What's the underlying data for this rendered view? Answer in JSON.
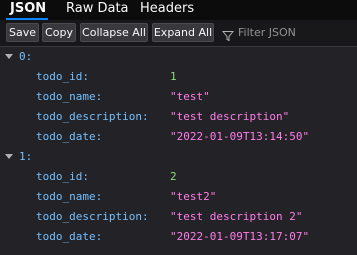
{
  "tabs": [
    {
      "label": "JSON"
    },
    {
      "label": "Raw Data"
    },
    {
      "label": "Headers"
    }
  ],
  "toolbar": {
    "save_label": "Save",
    "copy_label": "Copy",
    "collapse_label": "Collapse All",
    "expand_label": "Expand All",
    "filter_placeholder": "Filter JSON",
    "filter_icon": "filter-icon"
  },
  "colors": {
    "background": "#232327",
    "key": "#75bfff",
    "number": "#86de74",
    "string": "#ff7de9",
    "active_tab": "#0a84ff"
  },
  "items": [
    {
      "index": "0:",
      "fields": [
        {
          "key": "todo_id:",
          "value": "1"
        },
        {
          "key": "todo_name:",
          "value": "\"test\""
        },
        {
          "key": "todo_description:",
          "value": "\"test description\""
        },
        {
          "key": "todo_date:",
          "value": "\"2022-01-09T13:14:50\""
        }
      ]
    },
    {
      "index": "1:",
      "fields": [
        {
          "key": "todo_id:",
          "value": "2"
        },
        {
          "key": "todo_name:",
          "value": "\"test2\""
        },
        {
          "key": "todo_description:",
          "value": "\"test description 2\""
        },
        {
          "key": "todo_date:",
          "value": "\"2022-01-09T13:17:07\""
        }
      ]
    }
  ]
}
